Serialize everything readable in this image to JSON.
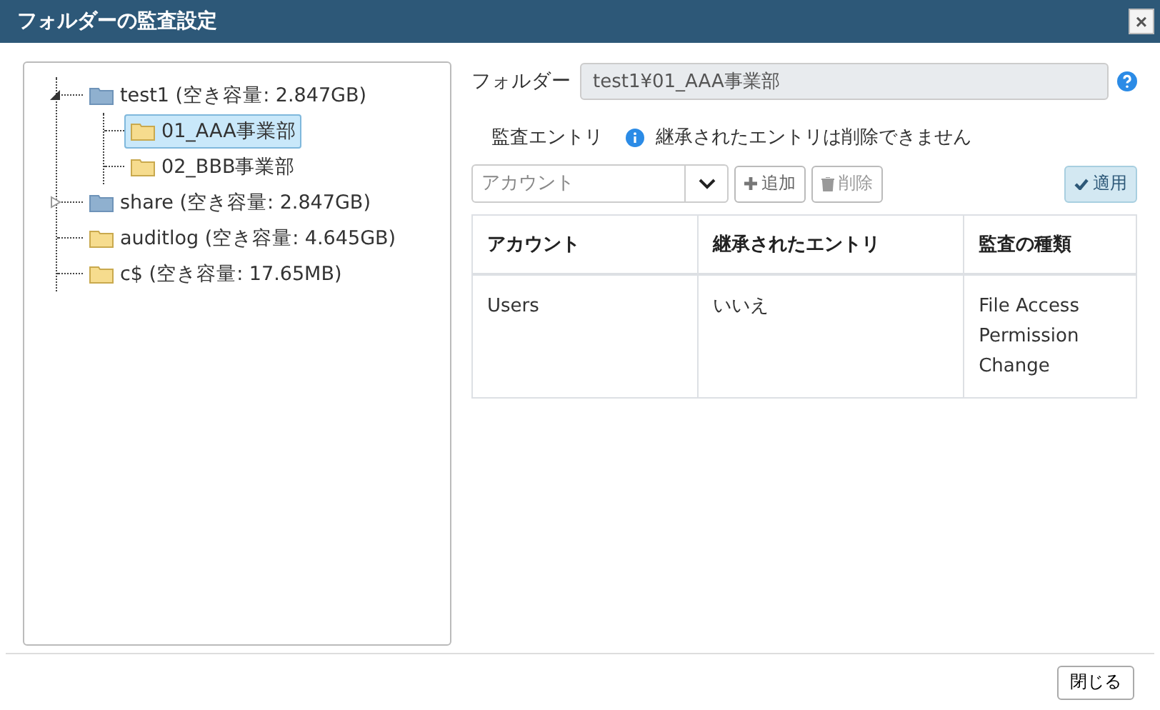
{
  "window": {
    "title": "フォルダーの監査設定",
    "close": "×"
  },
  "tree": [
    {
      "label": "test1 (空き容量: 2.847GB)",
      "kind": "drive",
      "expanded": true,
      "selected": false,
      "children": [
        {
          "label": "01_AAA事業部",
          "kind": "folder",
          "selected": true
        },
        {
          "label": "02_BBB事業部",
          "kind": "folder",
          "selected": false
        }
      ]
    },
    {
      "label": "share (空き容量: 2.847GB)",
      "kind": "drive",
      "expanded": false,
      "selected": false
    },
    {
      "label": "auditlog (空き容量: 4.645GB)",
      "kind": "folder",
      "selected": false
    },
    {
      "label": "c$ (空き容量: 17.65MB)",
      "kind": "folder",
      "selected": false
    }
  ],
  "folder": {
    "label": "フォルダー",
    "value": "test1¥01_AAA事業部"
  },
  "entries": {
    "label": "監査エントリ",
    "note": "継承されたエントリは削除できません"
  },
  "toolbar": {
    "account_placeholder": "アカウント",
    "add": "追加",
    "delete": "削除",
    "delete_disabled": true,
    "apply": "適用"
  },
  "table": {
    "columns": [
      "アカウント",
      "継承されたエントリ",
      "監査の種類"
    ],
    "rows": [
      [
        "Users",
        "いいえ",
        "File Access Permission Change"
      ]
    ]
  },
  "footer": {
    "close": "閉じる"
  }
}
